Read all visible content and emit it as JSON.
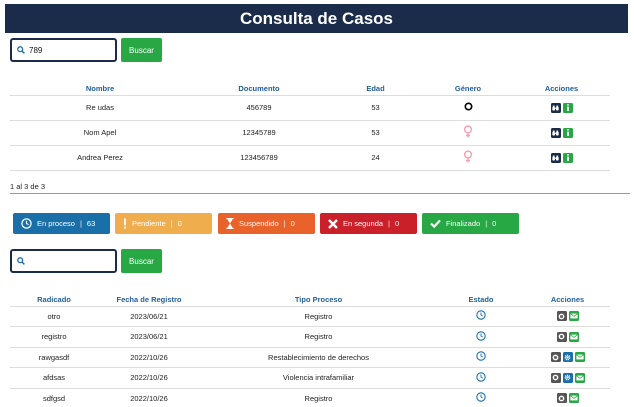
{
  "header": {
    "title": "Consulta de Casos"
  },
  "search1": {
    "value": "789",
    "button_label": "Buscar"
  },
  "persons_table": {
    "columns": [
      "Nombre",
      "Documento",
      "Edad",
      "Género",
      "Acciones"
    ],
    "rows": [
      {
        "nombre": "Re udas",
        "documento": "456789",
        "edad": "53",
        "genero": "other"
      },
      {
        "nombre": "Nom Apel",
        "documento": "12345789",
        "edad": "53",
        "genero": "female"
      },
      {
        "nombre": "Andrea Perez",
        "documento": "123456789",
        "edad": "24",
        "genero": "female"
      }
    ]
  },
  "pagination": {
    "text": "1 al 3 de 3"
  },
  "status_filters": [
    {
      "label": "En proceso",
      "count": "63",
      "color": "#1a6fa8",
      "icon": "clock-icon"
    },
    {
      "label": "Pendiente",
      "count": "0",
      "color": "#f0ad4e",
      "icon": "exclamation-icon"
    },
    {
      "label": "Suspendido",
      "count": "0",
      "color": "#e8622a",
      "icon": "hourglass-icon"
    },
    {
      "label": "En segunda",
      "count": "0",
      "color": "#c9202a",
      "icon": "x-icon"
    },
    {
      "label": "Finalizado",
      "count": "0",
      "color": "#28a745",
      "icon": "check-icon"
    }
  ],
  "search2": {
    "value": "",
    "button_label": "Buscar"
  },
  "cases_table": {
    "columns": [
      "Radicado",
      "Fecha de Registro",
      "Tipo Proceso",
      "Estado",
      "Acciones"
    ],
    "rows": [
      {
        "radicado": "otro",
        "fecha": "2023/06/21",
        "tipo": "Registro",
        "actions": 2
      },
      {
        "radicado": "registro",
        "fecha": "2023/06/21",
        "tipo": "Registro",
        "actions": 2
      },
      {
        "radicado": "rawgasdf",
        "fecha": "2022/10/26",
        "tipo": "Restablecimiento de derechos",
        "actions": 3
      },
      {
        "radicado": "afdsas",
        "fecha": "2022/10/26",
        "tipo": "Violencia intrafamiliar",
        "actions": 3
      },
      {
        "radicado": "sdfgsd",
        "fecha": "2022/10/26",
        "tipo": "Registro",
        "actions": 2
      }
    ]
  }
}
